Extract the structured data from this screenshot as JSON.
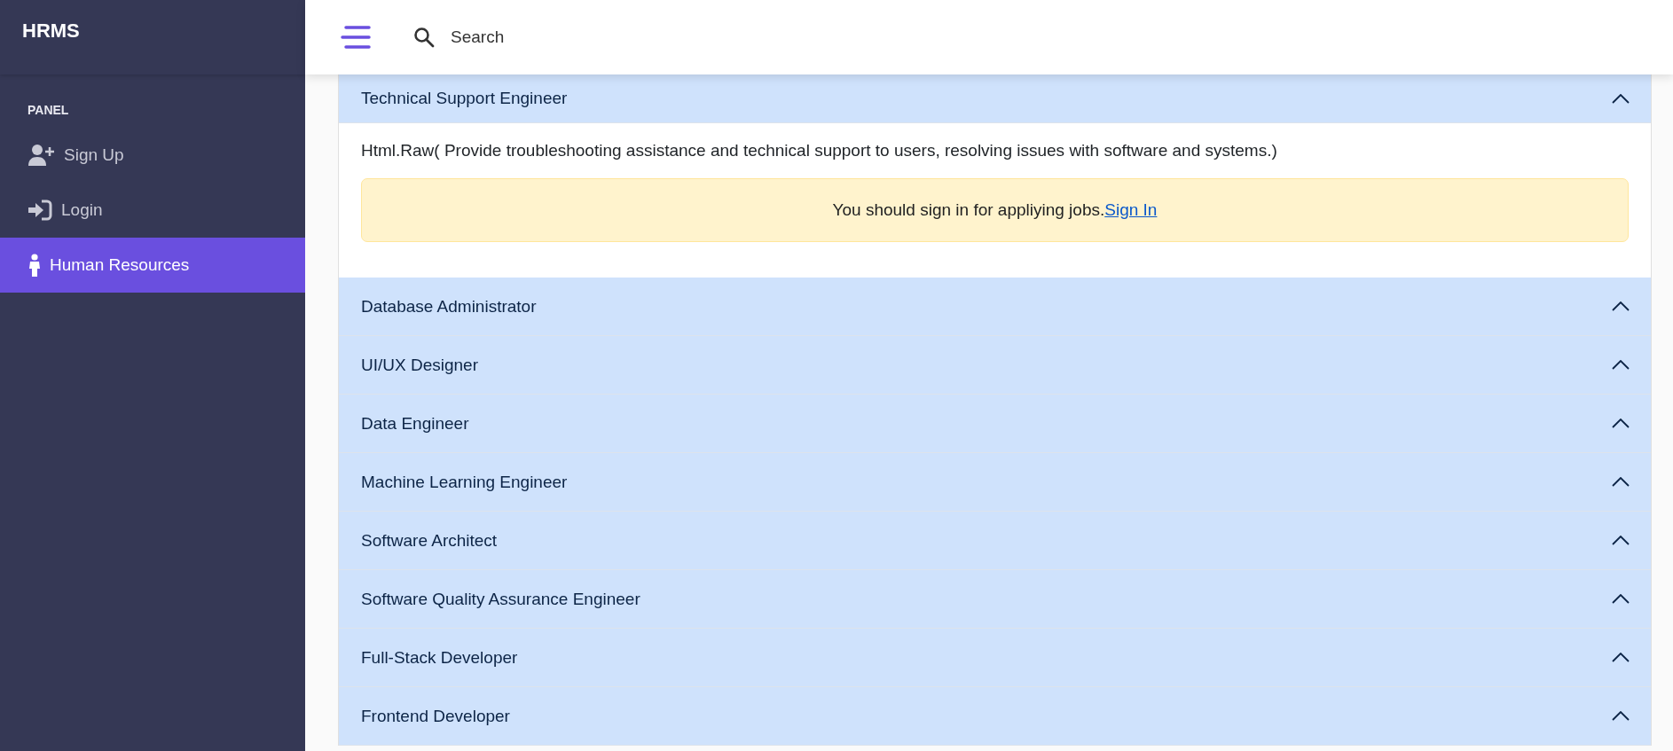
{
  "brand": "HRMS",
  "sidebar": {
    "section": "PANEL",
    "items": [
      {
        "label": "Sign Up",
        "selected": false
      },
      {
        "label": "Login",
        "selected": false
      },
      {
        "label": "Human Resources",
        "selected": true
      }
    ]
  },
  "search": {
    "placeholder": "Search"
  },
  "jobs": [
    {
      "title": "Technical Support Engineer",
      "expanded": true,
      "description": "Html.Raw( Provide troubleshooting assistance and technical support to users, resolving issues with software and systems.)",
      "alert": {
        "text": "You should sign in for appliying jobs.",
        "link": "Sign In"
      }
    },
    {
      "title": "Database Administrator",
      "expanded": false
    },
    {
      "title": "UI/UX Designer",
      "expanded": false
    },
    {
      "title": "Data Engineer",
      "expanded": false
    },
    {
      "title": "Machine Learning Engineer",
      "expanded": false
    },
    {
      "title": "Software Architect",
      "expanded": false
    },
    {
      "title": "Software Quality Assurance Engineer",
      "expanded": false
    },
    {
      "title": "Full-Stack Developer",
      "expanded": false
    },
    {
      "title": "Frontend Developer",
      "expanded": false
    }
  ]
}
